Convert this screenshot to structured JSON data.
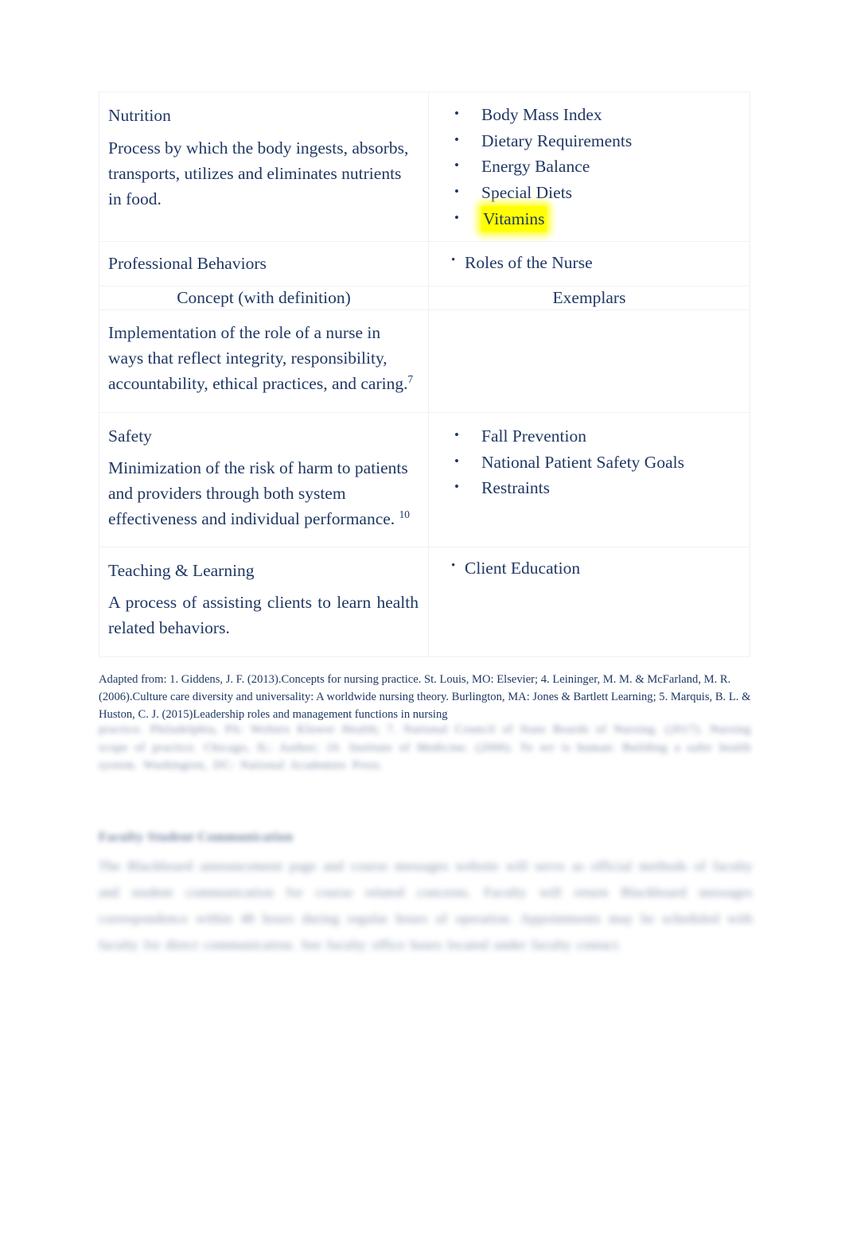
{
  "document": {
    "type": "concept-exemplar-table",
    "text_color": "#1f3864",
    "highlight_color": "#ffff00"
  },
  "table": {
    "header": {
      "concept_label": "Concept  (with definition)",
      "exemplars_label": "Exemplars"
    },
    "rows": [
      {
        "concept_title": "Nutrition",
        "concept_definition": "Process by which the body ingests, absorbs, transports, utilizes and eliminates nutrients in food.",
        "reference": "",
        "exemplars": [
          {
            "text": "Body Mass Index",
            "highlighted": false
          },
          {
            "text": "Dietary Requirements",
            "highlighted": false
          },
          {
            "text": "Energy Balance",
            "highlighted": false
          },
          {
            "text": "Special Diets",
            "highlighted": false
          },
          {
            "text": "Vitamins",
            "highlighted": true
          }
        ]
      },
      {
        "concept_title": "Professional Behaviors",
        "concept_definition": "",
        "reference": "",
        "exemplars": [
          {
            "text": "Roles of the Nurse",
            "highlighted": false
          }
        ]
      },
      {
        "concept_title": "",
        "concept_definition": "Implementation of the role of a nurse in ways that reflect integrity, responsibility, accountability, ethical practices, and caring.",
        "reference": "7",
        "exemplars": []
      },
      {
        "concept_title": "Safety",
        "concept_definition": "Minimization of the risk of harm to patients and providers through both system effectiveness and individual performance.",
        "reference": "10",
        "exemplars": [
          {
            "text": "Fall Prevention",
            "highlighted": false
          },
          {
            "text": "National Patient Safety Goals",
            "highlighted": false
          },
          {
            "text": "Restraints",
            "highlighted": false
          }
        ]
      },
      {
        "concept_title": "Teaching & Learning",
        "concept_definition": "A process of assisting clients to learn health related behaviors.",
        "reference": "",
        "exemplars": [
          {
            "text": "Client Education",
            "highlighted": false
          }
        ]
      }
    ]
  },
  "footnote": {
    "text": "Adapted from: 1. Giddens, J. F. (2013).Concepts for nursing practice. St. Louis, MO: Elsevier; 4. Leininger, M. M. & McFarland, M. R. (2006).Culture care diversity and universality: A worldwide nursing theory. Burlington, MA: Jones & Bartlett Learning; 5. Marquis, B. L. & Huston, C. J. (2015)Leadership roles and management functions in nursing"
  },
  "blurred": {
    "paragraph_one": "practice. Philadelphia, PA: Wolters Kluwer Health; 7. National Council of State Boards of Nursing. (2017). Nursing scope of practice. Chicago, IL: Author; 10. Institute of Medicine. (2000). To err is human: Building a safer health system. Washington, DC: National Academies Press.",
    "heading": "Faculty Student Communication",
    "paragraph_two": "The Blackboard announcement page and course messages website will serve as official methods of faculty and student communication for course related concerns. Faculty will return Blackboard messages correspondence within 48 hours during regular hours of operation. Appointments may be scheduled with faculty for direct communication. See faculty office hours located under faculty contact."
  }
}
